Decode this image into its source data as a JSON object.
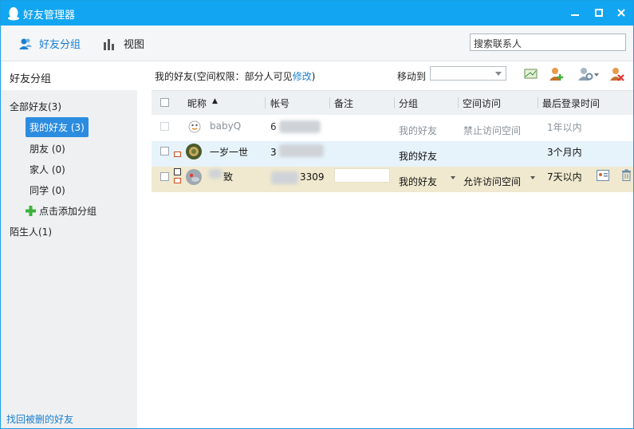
{
  "window": {
    "title": "好友管理器",
    "min_glyph": "━",
    "max_glyph": "□",
    "close_glyph": "✕"
  },
  "toolbar": {
    "friend_group": "好友分组",
    "view": "视图",
    "search_value": "搜索联系人"
  },
  "sidebar": {
    "header": "好友分组",
    "all": "全部好友(3)",
    "groups": [
      "我的好友 (3)",
      "朋友 (0)",
      "家人 (0)",
      "同学 (0)"
    ],
    "add_group": "点击添加分组",
    "strangers": "陌生人(1)",
    "footer": "找回被删的好友"
  },
  "main": {
    "title_prefix": "我的好友(空间权限：部分人可见",
    "edit_link": "修改",
    "title_suffix": ")",
    "move_to": "移动到",
    "move_to_value": ""
  },
  "table": {
    "headers": [
      "昵称",
      "帐号",
      "备注",
      "分组",
      "空间访问",
      "最后登录时间"
    ],
    "rows": [
      {
        "nickname": "babyQ",
        "account": "6",
        "note": "",
        "group": "我的好友",
        "space": "禁止访问空间",
        "last_login": "1年以内"
      },
      {
        "nickname": "一岁一世",
        "account": "3",
        "note": "",
        "group": "我的好友",
        "space": "",
        "last_login": "3个月内"
      },
      {
        "nickname": "致",
        "account": "3309",
        "note": "",
        "group": "我的好友",
        "space": "允许访问空间",
        "last_login": "7天以内"
      }
    ]
  },
  "colors": {
    "accent": "#12a6f2",
    "link": "#1a7fd0",
    "selected_row": "#f0e9cf",
    "hover_row": "#e6f3fb"
  }
}
